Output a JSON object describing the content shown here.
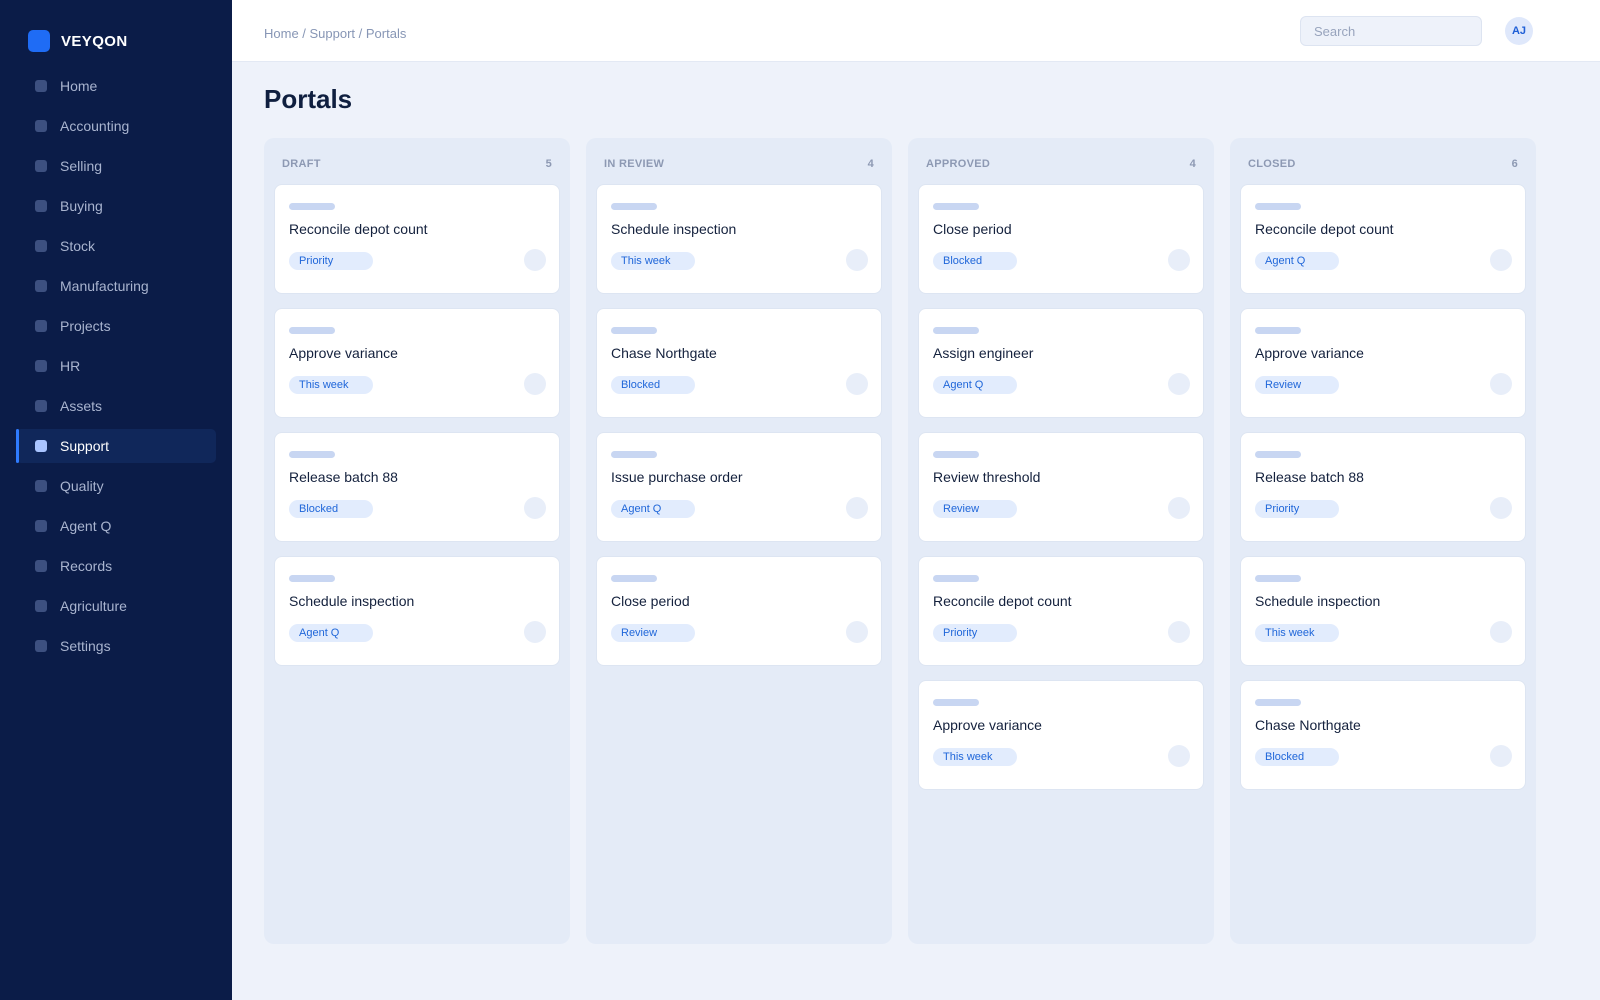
{
  "app": {
    "brand": "VEYQON"
  },
  "sidebar": {
    "items": [
      {
        "id": "home",
        "label": "Home",
        "active": false
      },
      {
        "id": "accounting",
        "label": "Accounting",
        "active": false
      },
      {
        "id": "selling",
        "label": "Selling",
        "active": false
      },
      {
        "id": "buying",
        "label": "Buying",
        "active": false
      },
      {
        "id": "stock",
        "label": "Stock",
        "active": false
      },
      {
        "id": "manufacturing",
        "label": "Manufacturing",
        "active": false
      },
      {
        "id": "projects",
        "label": "Projects",
        "active": false
      },
      {
        "id": "hr",
        "label": "HR",
        "active": false
      },
      {
        "id": "assets",
        "label": "Assets",
        "active": false
      },
      {
        "id": "support",
        "label": "Support",
        "active": true
      },
      {
        "id": "quality",
        "label": "Quality",
        "active": false
      },
      {
        "id": "agent-q",
        "label": "Agent Q",
        "active": false
      },
      {
        "id": "records",
        "label": "Records",
        "active": false
      },
      {
        "id": "agriculture",
        "label": "Agriculture",
        "active": false
      },
      {
        "id": "settings",
        "label": "Settings",
        "active": false
      }
    ]
  },
  "header": {
    "breadcrumb": "Home / Support / Portals",
    "search_placeholder": "Search",
    "avatar_initials": "AJ"
  },
  "page": {
    "title": "Portals"
  },
  "board": {
    "columns": [
      {
        "name": "DRAFT",
        "count": "5",
        "cards": [
          {
            "title": "Reconcile depot count",
            "tag": "Priority"
          },
          {
            "title": "Approve variance",
            "tag": "This week"
          },
          {
            "title": "Release batch 88",
            "tag": "Blocked"
          },
          {
            "title": "Schedule inspection",
            "tag": "Agent Q"
          }
        ]
      },
      {
        "name": "IN REVIEW",
        "count": "4",
        "cards": [
          {
            "title": "Schedule inspection",
            "tag": "This week"
          },
          {
            "title": "Chase Northgate",
            "tag": "Blocked"
          },
          {
            "title": "Issue purchase order",
            "tag": "Agent Q"
          },
          {
            "title": "Close period",
            "tag": "Review"
          }
        ]
      },
      {
        "name": "APPROVED",
        "count": "4",
        "cards": [
          {
            "title": "Close period",
            "tag": "Blocked"
          },
          {
            "title": "Assign engineer",
            "tag": "Agent Q"
          },
          {
            "title": "Review threshold",
            "tag": "Review"
          },
          {
            "title": "Reconcile depot count",
            "tag": "Priority"
          },
          {
            "title": "Approve variance",
            "tag": "This week"
          }
        ]
      },
      {
        "name": "CLOSED",
        "count": "6",
        "cards": [
          {
            "title": "Reconcile depot count",
            "tag": "Agent Q"
          },
          {
            "title": "Approve variance",
            "tag": "Review"
          },
          {
            "title": "Release batch 88",
            "tag": "Priority"
          },
          {
            "title": "Schedule inspection",
            "tag": "This week"
          },
          {
            "title": "Chase Northgate",
            "tag": "Blocked"
          }
        ]
      }
    ]
  }
}
